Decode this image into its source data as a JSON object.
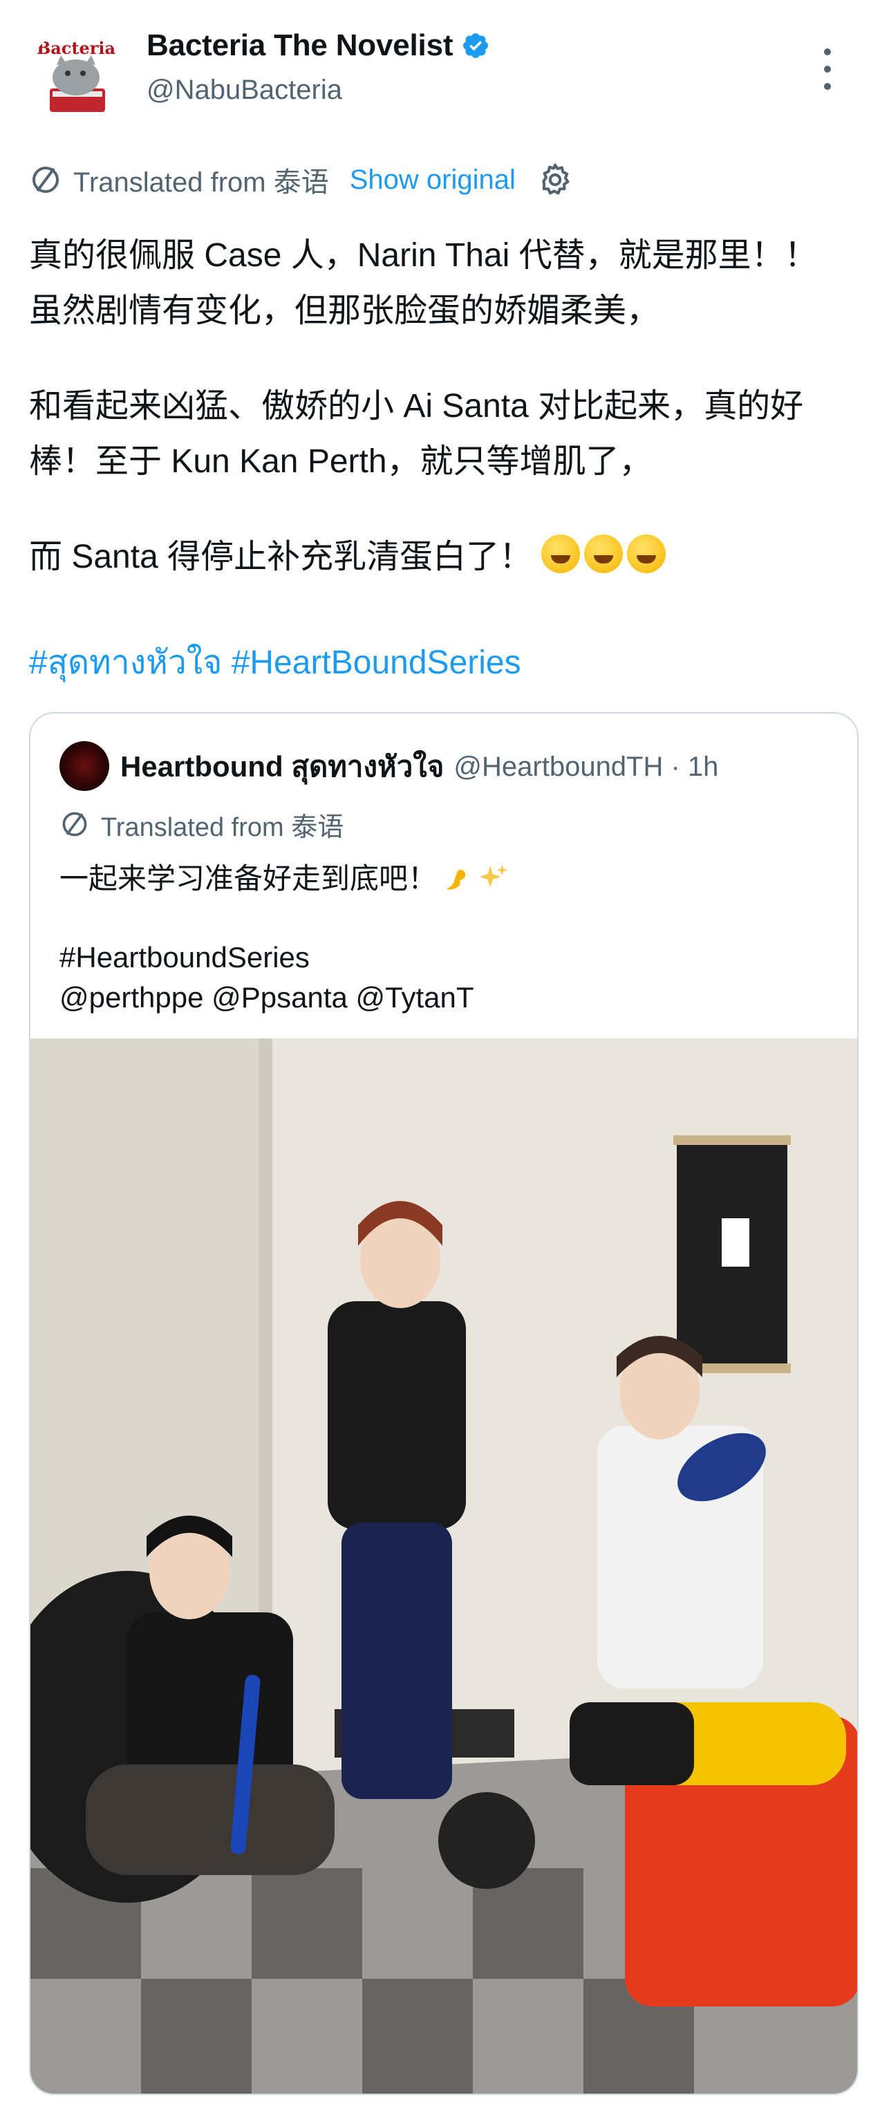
{
  "author": {
    "name": "Bacteria The Novelist",
    "handle": "@NabuBacteria",
    "avatar_text": "Bacteria"
  },
  "translation": {
    "label": "Translated from 泰语",
    "show_original": "Show original"
  },
  "tweet": {
    "paragraphs": [
      "真的很佩服 Case 人，Narin Thai 代替，就是那里！！ 虽然剧情有变化，但那张脸蛋的娇媚柔美，",
      "和看起来凶猛、傲娇的小 Ai Santa 对比起来，真的好棒！至于 Kun Kan Perth，就只等增肌了，",
      "而 Santa 得停止补充乳清蛋白了！"
    ],
    "hashtags": "#สุดทางหัวใจ #HeartBoundSeries"
  },
  "quote": {
    "name": "Heartbound สุดทางหัวใจ",
    "handle_time": "@HeartboundTH · 1h",
    "translation_label": "Translated from 泰语",
    "line1": "一起来学习准备好走到底吧！",
    "line2": "#HeartboundSeries",
    "line3": "@perthppe @Ppsanta @TytanT"
  },
  "colors": {
    "link": "#1d9bf0",
    "secondary_text": "#536471",
    "border": "#cfd9de"
  },
  "icons": [
    "verified-badge-icon",
    "more-options-icon",
    "translate-icon",
    "settings-gear-icon",
    "laughing-emoji-icon",
    "flexed-biceps-emoji-icon",
    "sparkles-emoji-icon"
  ]
}
